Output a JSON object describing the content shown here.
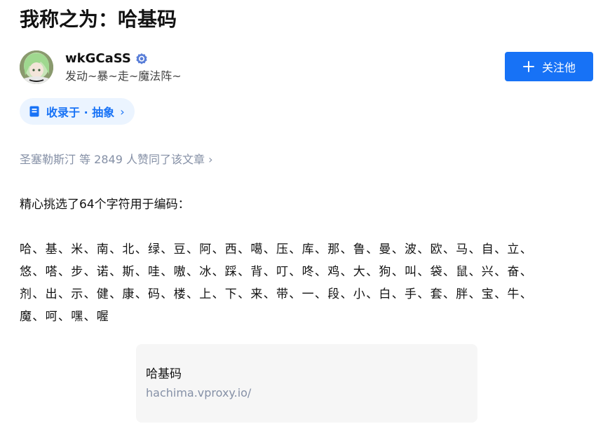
{
  "article": {
    "title": "我称之为：哈基码"
  },
  "author": {
    "name": "wkGCaSS",
    "bio": "发动~暴~走~魔法阵~",
    "verified_icon": "verified-badge-icon"
  },
  "follow_button": {
    "label": "关注他",
    "icon": "plus-icon"
  },
  "collection": {
    "label": "收录于 · 抽象",
    "icon": "book-icon",
    "chevron": "›"
  },
  "likes": {
    "text": "圣塞勒斯汀 等 2849 人赞同了该文章 ›"
  },
  "content": {
    "intro": "精心挑选了64个字符用于编码：",
    "char_lines": [
      "哈、基、米、南、北、绿、豆、阿、西、噶、压、库、那、鲁、曼、波、欧、马、自、立、",
      "悠、嗒、步、诺、斯、哇、嗷、冰、踩、背、叮、咚、鸡、大、狗、叫、袋、鼠、兴、奋、",
      "剂、出、示、健、康、码、楼、上、下、来、带、一、段、小、白、手、套、胖、宝、牛、",
      "魔、呵、嘿、喔"
    ]
  },
  "link_card": {
    "title": "哈基码",
    "url": "hachima.vproxy.io/"
  },
  "colors": {
    "brand_blue": "#1772f6",
    "tag_background": "#ebf4ff",
    "muted_text": "#8590a6",
    "card_background": "#f6f6f6"
  }
}
